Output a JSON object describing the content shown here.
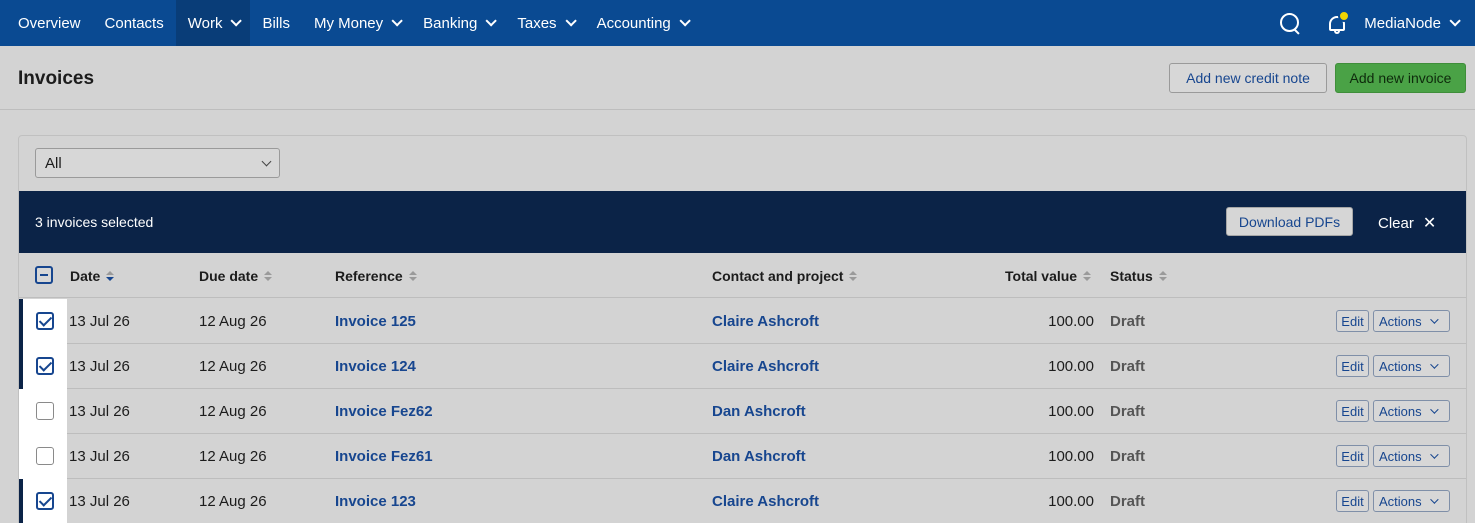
{
  "nav": {
    "items": [
      {
        "label": "Overview",
        "dropdown": false,
        "active": false
      },
      {
        "label": "Contacts",
        "dropdown": false,
        "active": false
      },
      {
        "label": "Work",
        "dropdown": true,
        "active": true
      },
      {
        "label": "Bills",
        "dropdown": false,
        "active": false
      },
      {
        "label": "My Money",
        "dropdown": true,
        "active": false
      },
      {
        "label": "Banking",
        "dropdown": true,
        "active": false
      },
      {
        "label": "Taxes",
        "dropdown": true,
        "active": false
      },
      {
        "label": "Accounting",
        "dropdown": true,
        "active": false
      }
    ],
    "user": "MediaNode",
    "icons": [
      "search-icon",
      "bell-icon"
    ],
    "colors": {
      "bar": "#0a4a92",
      "active": "#093d78",
      "notification_dot": "#f2d400"
    }
  },
  "page": {
    "title": "Invoices",
    "add_credit_note_label": "Add new credit note",
    "add_invoice_label": "Add new invoice"
  },
  "filter": {
    "selected": "All"
  },
  "bulk": {
    "selected_text": "3 invoices selected",
    "download_label": "Download PDFs",
    "clear_label": "Clear",
    "clear_icon": "✕"
  },
  "table": {
    "headers": {
      "date": "Date",
      "due_date": "Due date",
      "reference": "Reference",
      "contact": "Contact and project",
      "total": "Total value",
      "status": "Status"
    },
    "rows": [
      {
        "selected": true,
        "date": "13 Jul 26",
        "due": "12 Aug 26",
        "reference": "Invoice 125",
        "contact": "Claire Ashcroft",
        "total": "100.00",
        "status": "Draft",
        "edit": "Edit",
        "actions": "Actions"
      },
      {
        "selected": true,
        "date": "13 Jul 26",
        "due": "12 Aug 26",
        "reference": "Invoice 124",
        "contact": "Claire Ashcroft",
        "total": "100.00",
        "status": "Draft",
        "edit": "Edit",
        "actions": "Actions"
      },
      {
        "selected": false,
        "date": "13 Jul 26",
        "due": "12 Aug 26",
        "reference": "Invoice Fez62",
        "contact": "Dan Ashcroft",
        "total": "100.00",
        "status": "Draft",
        "edit": "Edit",
        "actions": "Actions"
      },
      {
        "selected": false,
        "date": "13 Jul 26",
        "due": "12 Aug 26",
        "reference": "Invoice Fez61",
        "contact": "Dan Ashcroft",
        "total": "100.00",
        "status": "Draft",
        "edit": "Edit",
        "actions": "Actions"
      },
      {
        "selected": true,
        "date": "13 Jul 26",
        "due": "12 Aug 26",
        "reference": "Invoice 123",
        "contact": "Claire Ashcroft",
        "total": "100.00",
        "status": "Draft",
        "edit": "Edit",
        "actions": "Actions"
      }
    ]
  }
}
